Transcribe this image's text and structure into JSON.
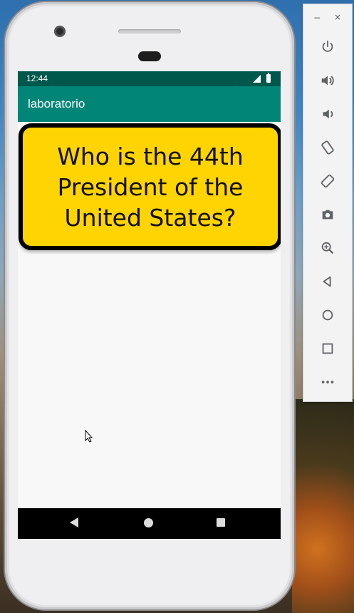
{
  "status_bar": {
    "time": "12:44"
  },
  "app_bar": {
    "title": "laboratorio"
  },
  "question": {
    "text": "Who is the 44th President of the United States?"
  },
  "colors": {
    "status_bar": "#00574b",
    "app_bar": "#008577",
    "card_fill": "#ffd400",
    "card_border": "#000000"
  },
  "nav_bar": {
    "back_icon": "back-triangle-icon",
    "home_icon": "home-circle-icon",
    "recents_icon": "recents-square-icon"
  },
  "emulator_panel": {
    "window_controls": {
      "minimize": "−",
      "close": "×"
    },
    "buttons": [
      "power-icon",
      "volume-up-icon",
      "volume-down-icon",
      "rotate-left-icon",
      "rotate-right-icon",
      "camera-icon",
      "zoom-icon",
      "back-icon",
      "home-icon",
      "overview-icon",
      "more-icon"
    ]
  }
}
